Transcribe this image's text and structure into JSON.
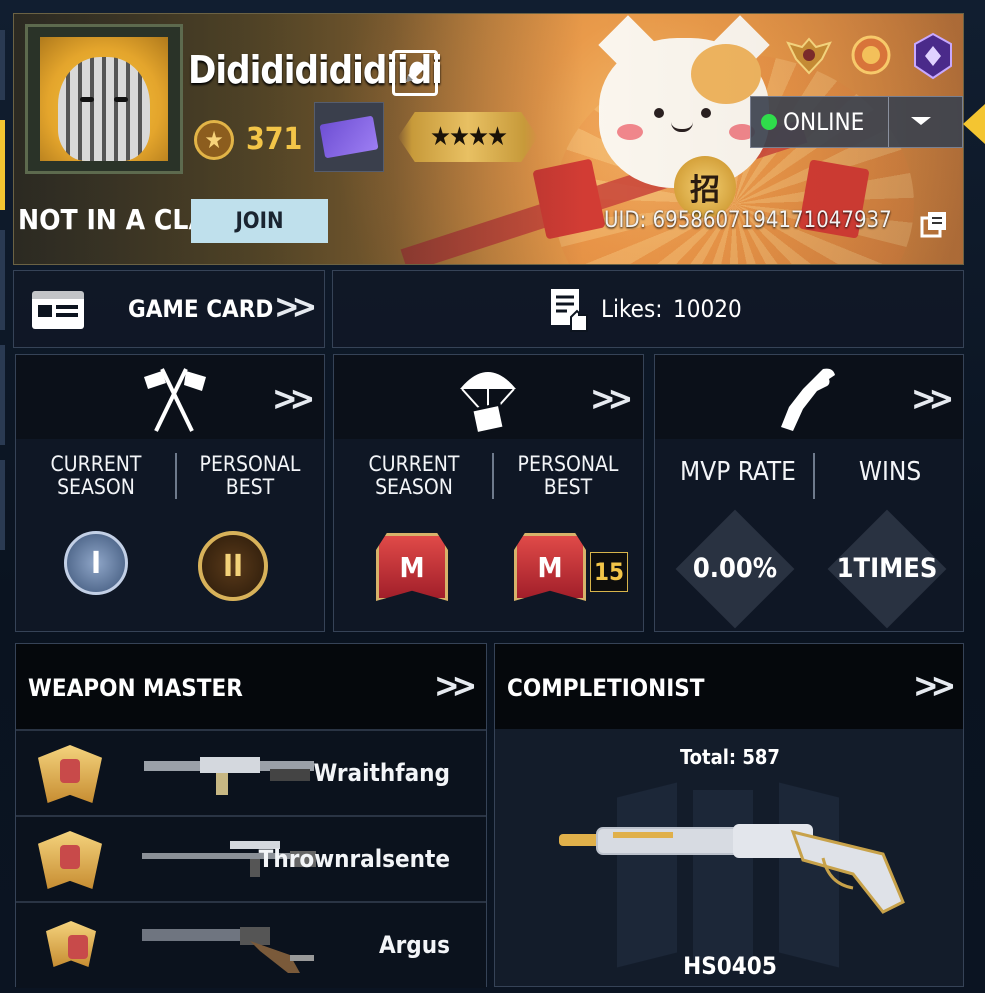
{
  "profile": {
    "name": "Didididididiidi",
    "level": "371",
    "clan_status": "NOT IN A CLAN",
    "join_label": "JOIN",
    "uid": "UID: 6958607194171047937",
    "rank_stars": "★★★★",
    "status": "ONLINE"
  },
  "game_card": {
    "label": "GAME CARD"
  },
  "likes": {
    "label": "Likes:",
    "value": "10020"
  },
  "mp_stats": {
    "current": "CURRENT SEASON",
    "best": "PERSONAL BEST",
    "current_rank": "I",
    "best_rank": "II"
  },
  "br_stats": {
    "current": "CURRENT SEASON",
    "best": "PERSONAL BEST",
    "best_badge": "15"
  },
  "zombie_stats": {
    "mvp_label": "MVP RATE",
    "wins_label": "WINS",
    "mvp_value": "0.00%",
    "wins_value": "1TIMES"
  },
  "weapon_master": {
    "title": "WEAPON MASTER",
    "weapons": [
      {
        "name": "Wraithfang"
      },
      {
        "name": "Thrownralsente"
      },
      {
        "name": "Argus"
      }
    ]
  },
  "completionist": {
    "title": "COMPLETIONIST",
    "total": "Total: 587",
    "weapon": "HS0405"
  },
  "colors": {
    "accent": "#f4c531",
    "online": "#2fdd4b",
    "join_bg": "#bfe0ec"
  }
}
